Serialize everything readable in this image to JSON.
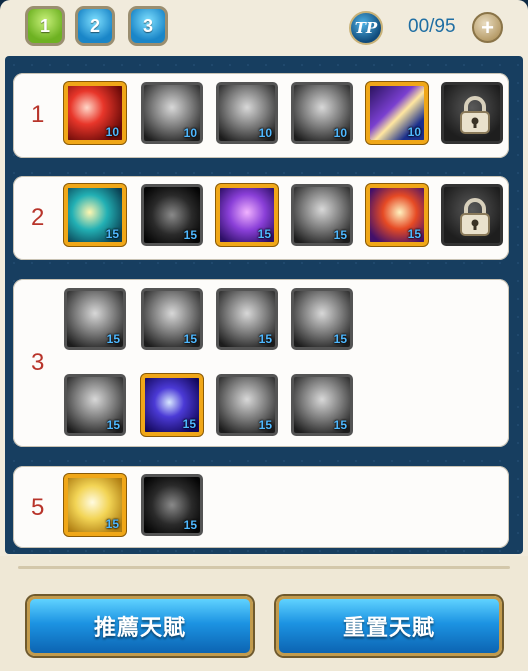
{
  "pages": [
    {
      "label": "1",
      "active": true
    },
    {
      "label": "2",
      "active": false
    },
    {
      "label": "3",
      "active": false
    }
  ],
  "tp": {
    "icon_label": "TP",
    "count": "00/95",
    "add_label": "+"
  },
  "rows": [
    {
      "label": "1",
      "slots": [
        {
          "lit": true,
          "level": "10",
          "icon": "red-slash-skill-icon",
          "art": "red"
        },
        {
          "lit": false,
          "level": "10",
          "icon": "armor-torso-skill-icon",
          "art": "grey"
        },
        {
          "lit": false,
          "level": "10",
          "icon": "gauntlet-skill-icon",
          "art": "grey"
        },
        {
          "lit": false,
          "level": "10",
          "icon": "muscle-body-skill-icon",
          "art": "grey"
        },
        {
          "lit": true,
          "level": "10",
          "icon": "crushing-blow-skill-icon",
          "art": "purple"
        },
        {
          "lock": true,
          "icon": "padlock-icon"
        }
      ]
    },
    {
      "label": "2",
      "slots": [
        {
          "lit": true,
          "level": "15",
          "icon": "triple-arrow-skill-icon",
          "art": "teal"
        },
        {
          "lit": false,
          "level": "15",
          "icon": "eye-skill-icon",
          "art": "dark"
        },
        {
          "lit": true,
          "level": "15",
          "icon": "purple-warrior-skill-icon",
          "art": "violet"
        },
        {
          "lit": false,
          "level": "15",
          "icon": "light-beam-skill-icon",
          "art": "grey"
        },
        {
          "lit": true,
          "level": "15",
          "icon": "sword-burst-skill-icon",
          "art": "fire"
        },
        {
          "lock": true,
          "icon": "padlock-icon"
        }
      ]
    },
    {
      "label": "3",
      "slots": [
        {
          "lit": false,
          "level": "15",
          "icon": "shatter-skill-icon",
          "art": "grey"
        },
        {
          "lit": false,
          "level": "15",
          "icon": "spark-burst-skill-icon",
          "art": "grey"
        },
        {
          "lit": false,
          "level": "15",
          "icon": "wind-slash-skill-icon",
          "art": "grey"
        },
        {
          "lit": false,
          "level": "15",
          "icon": "whirl-skill-icon",
          "art": "grey"
        },
        {
          "lit": false,
          "level": "15",
          "icon": "claw-strike-skill-icon",
          "art": "grey"
        },
        {
          "lit": true,
          "level": "15",
          "icon": "cosmic-slash-skill-icon",
          "art": "cosmic"
        },
        {
          "lit": false,
          "level": "15",
          "icon": "white-beast-skill-icon",
          "art": "grey"
        },
        {
          "lit": false,
          "level": "15",
          "icon": "fury-beast-skill-icon",
          "art": "grey"
        }
      ]
    },
    {
      "label": "5",
      "slots": [
        {
          "lit": true,
          "level": "15",
          "icon": "golden-aura-skill-icon",
          "art": "gold"
        },
        {
          "lit": false,
          "level": "15",
          "icon": "shadow-warrior-skill-icon",
          "art": "dark"
        }
      ]
    }
  ],
  "buttons": {
    "recommend": "推薦天賦",
    "reset": "重置天賦"
  },
  "colors": {
    "lit_border": "#f0a718",
    "row_label": "#b8342a",
    "level_text": "#4fb8ff",
    "field": "#173e60"
  }
}
